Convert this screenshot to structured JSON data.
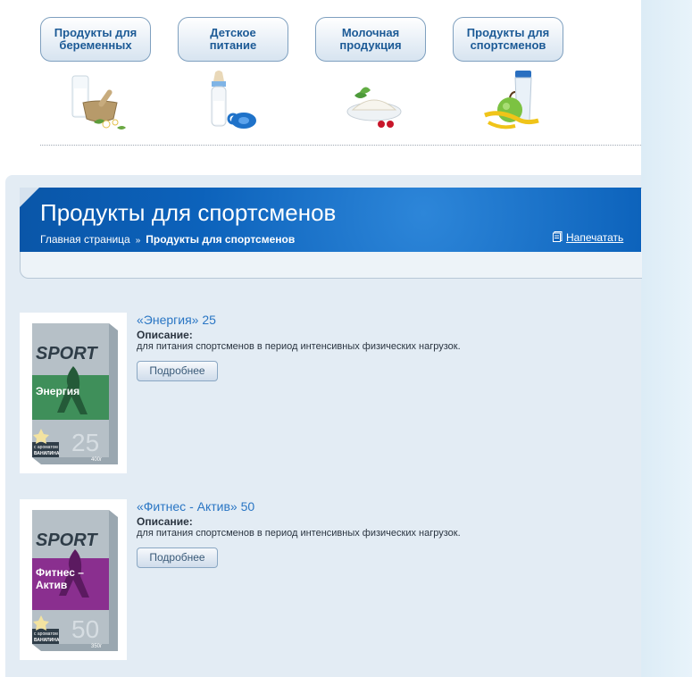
{
  "categories": [
    {
      "line1": "Продукты для",
      "line2": "беременных",
      "icon": "milk-herbs-icon"
    },
    {
      "line1": "Детское",
      "line2": "питание",
      "icon": "baby-bottle-icon"
    },
    {
      "line1": "Молочная",
      "line2": "продукция",
      "icon": "cottage-cheese-icon"
    },
    {
      "line1": "Продукты для",
      "line2": "спортсменов",
      "icon": "shaker-apple-icon"
    }
  ],
  "page": {
    "title": "Продукты для спортсменов",
    "breadcrumb_home": "Главная страница",
    "breadcrumb_sep": "»",
    "breadcrumb_current": "Продукты для спортсменов",
    "print_label": "Напечатать"
  },
  "products": [
    {
      "title": "«Энергия» 25",
      "desc_label": "Описание:",
      "desc": "для питания спортсменов в период интенсивных физических нагрузок.",
      "button": "Подробнее",
      "box": {
        "brand": "SPORT",
        "name_line1": "Энергия",
        "name_line2": "",
        "number": "25",
        "flavor_line1": "с ароматом",
        "flavor_line2": "ВАНИЛИНА",
        "weight": "400г",
        "color": "#3f8f5a"
      }
    },
    {
      "title": "«Фитнес - Актив» 50",
      "desc_label": "Описание:",
      "desc": "для питания спортсменов в период интенсивных физических нагрузок.",
      "button": "Подробнее",
      "box": {
        "brand": "SPORT",
        "name_line1": "Фитнес –",
        "name_line2": "Актив",
        "number": "50",
        "flavor_line1": "с ароматом",
        "flavor_line2": "ВАНИЛИНА",
        "weight": "350г",
        "color": "#8a2f8f"
      }
    }
  ],
  "colors": {
    "accent": "#0c62bb",
    "link": "#2a76c4",
    "panel": "#e3ecf4"
  }
}
